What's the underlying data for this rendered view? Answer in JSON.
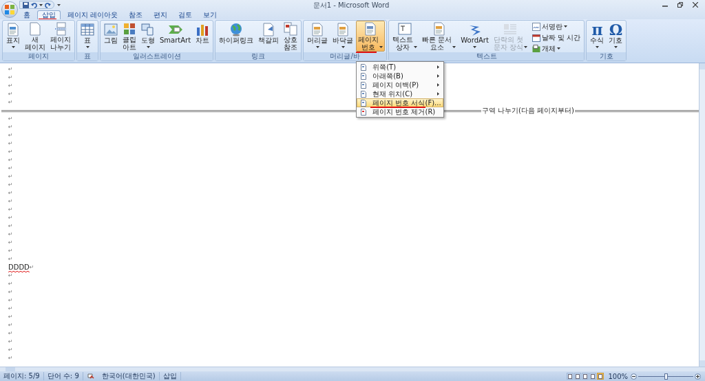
{
  "window": {
    "title": "문서1 - Microsoft Word"
  },
  "tabs": [
    {
      "label": "홈",
      "selected": false
    },
    {
      "label": "삽입",
      "selected": true
    },
    {
      "label": "페이지 레이아웃",
      "selected": false
    },
    {
      "label": "참조",
      "selected": false
    },
    {
      "label": "편지",
      "selected": false
    },
    {
      "label": "검토",
      "selected": false
    },
    {
      "label": "보기",
      "selected": false
    }
  ],
  "ribbon": {
    "groups": [
      {
        "label": "페이지",
        "buttons": [
          {
            "kind": "large",
            "label": "표지",
            "dropdown": true,
            "pressed": false,
            "disabled": false
          },
          {
            "kind": "large",
            "label": "새\n페이지",
            "dropdown": false,
            "pressed": false,
            "disabled": false
          },
          {
            "kind": "large",
            "label": "페이지\n나누기",
            "dropdown": false,
            "pressed": false,
            "disabled": false
          }
        ]
      },
      {
        "label": "표",
        "buttons": [
          {
            "kind": "large",
            "label": "표",
            "dropdown": true,
            "pressed": false,
            "disabled": false
          }
        ]
      },
      {
        "label": "일러스트레이션",
        "buttons": [
          {
            "kind": "large",
            "label": "그림",
            "dropdown": false,
            "pressed": false,
            "disabled": false
          },
          {
            "kind": "large",
            "label": "클립\n아트",
            "dropdown": false,
            "pressed": false,
            "disabled": false
          },
          {
            "kind": "large",
            "label": "도형",
            "dropdown": true,
            "pressed": false,
            "disabled": false
          },
          {
            "kind": "large",
            "label": "SmartArt",
            "dropdown": false,
            "pressed": false,
            "disabled": false
          },
          {
            "kind": "large",
            "label": "차트",
            "dropdown": false,
            "pressed": false,
            "disabled": false
          }
        ]
      },
      {
        "label": "링크",
        "buttons": [
          {
            "kind": "large",
            "label": "하이퍼링크",
            "dropdown": false,
            "pressed": false,
            "disabled": false
          },
          {
            "kind": "large",
            "label": "책갈피",
            "dropdown": false,
            "pressed": false,
            "disabled": false
          },
          {
            "kind": "large",
            "label": "상호\n참조",
            "dropdown": false,
            "pressed": false,
            "disabled": false
          }
        ]
      },
      {
        "label": "머리글/바",
        "buttons": [
          {
            "kind": "large",
            "label": "머리글",
            "dropdown": true,
            "pressed": false,
            "disabled": false
          },
          {
            "kind": "large",
            "label": "바닥글",
            "dropdown": true,
            "pressed": false,
            "disabled": false
          },
          {
            "kind": "large",
            "label": "페이지\n번호",
            "dropdown": true,
            "pressed": true,
            "disabled": false
          }
        ]
      },
      {
        "label": "텍스트",
        "buttons": [
          {
            "kind": "large",
            "label": "텍스트\n상자",
            "dropdown": true,
            "pressed": false,
            "disabled": false
          },
          {
            "kind": "large",
            "label": "빠른 문서\n요소",
            "dropdown": true,
            "pressed": false,
            "disabled": false
          },
          {
            "kind": "large",
            "label": "WordArt",
            "dropdown": true,
            "pressed": false,
            "disabled": false
          },
          {
            "kind": "large",
            "label": "단락의 첫\n문자 장식",
            "dropdown": true,
            "pressed": false,
            "disabled": true
          },
          {
            "kind": "small",
            "label": "서명란",
            "dropdown": true,
            "pressed": false,
            "disabled": false
          },
          {
            "kind": "small",
            "label": "날짜 및 시간",
            "dropdown": false,
            "pressed": false,
            "disabled": false
          },
          {
            "kind": "small",
            "label": "개체",
            "dropdown": true,
            "pressed": false,
            "disabled": false
          }
        ]
      },
      {
        "label": "기호",
        "buttons": [
          {
            "kind": "glyph",
            "glyph": "π",
            "label": "수식",
            "dropdown": true,
            "pressed": false,
            "disabled": false
          },
          {
            "kind": "glyph",
            "glyph": "Ω",
            "label": "기호",
            "dropdown": true,
            "pressed": false,
            "disabled": false
          }
        ]
      }
    ]
  },
  "menu": {
    "items": [
      {
        "label": "위쪽(T)",
        "submenu": true,
        "selected": false
      },
      {
        "label": "아래쪽(B)",
        "submenu": true,
        "selected": false
      },
      {
        "label": "페이지 여백(P)",
        "submenu": true,
        "selected": false
      },
      {
        "label": "현재 위치(C)",
        "submenu": true,
        "selected": false
      },
      {
        "label": "페이지 번호 서식(F)...",
        "submenu": false,
        "selected": true
      },
      {
        "label": "페이지 번호 제거(R)",
        "submenu": false,
        "selected": false
      }
    ]
  },
  "document": {
    "lines": [
      {
        "kind": "empty",
        "mark": "↵"
      },
      {
        "kind": "empty",
        "mark": "↵"
      },
      {
        "kind": "empty",
        "mark": "↵"
      },
      {
        "kind": "empty",
        "mark": "↵"
      },
      {
        "kind": "empty",
        "mark": "↵"
      },
      {
        "kind": "section_break",
        "text": "구역 나누기(다음 페이지부터)"
      },
      {
        "kind": "empty",
        "mark": "↵"
      },
      {
        "kind": "empty",
        "mark": "↵"
      },
      {
        "kind": "empty",
        "mark": "↵"
      },
      {
        "kind": "empty",
        "mark": "↵"
      },
      {
        "kind": "empty",
        "mark": "↵"
      },
      {
        "kind": "empty",
        "mark": "↵"
      },
      {
        "kind": "empty",
        "mark": "↵"
      },
      {
        "kind": "empty",
        "mark": "↵"
      },
      {
        "kind": "empty",
        "mark": "↵"
      },
      {
        "kind": "empty",
        "mark": "↵"
      },
      {
        "kind": "empty",
        "mark": "↵"
      },
      {
        "kind": "empty",
        "mark": "↵"
      },
      {
        "kind": "empty",
        "mark": "↵"
      },
      {
        "kind": "empty",
        "mark": "↵"
      },
      {
        "kind": "empty",
        "mark": "↵"
      },
      {
        "kind": "empty",
        "mark": "↵"
      },
      {
        "kind": "empty",
        "mark": "↵"
      },
      {
        "kind": "empty",
        "mark": "↵"
      },
      {
        "kind": "para",
        "text": "DDDD",
        "mark": "↵",
        "misspelled": true
      },
      {
        "kind": "empty",
        "mark": "↵"
      },
      {
        "kind": "empty",
        "mark": "↵"
      },
      {
        "kind": "empty",
        "mark": "↵"
      },
      {
        "kind": "empty",
        "mark": "↵"
      },
      {
        "kind": "empty",
        "mark": "↵"
      },
      {
        "kind": "empty",
        "mark": "↵"
      },
      {
        "kind": "empty",
        "mark": "↵"
      },
      {
        "kind": "empty",
        "mark": "↵"
      },
      {
        "kind": "empty",
        "mark": "↵"
      },
      {
        "kind": "empty",
        "mark": "↵"
      },
      {
        "kind": "empty",
        "mark": "↵"
      }
    ]
  },
  "status_bar": {
    "items": [
      "페이지: 5/9",
      "단어 수: 9",
      "한국어(대한민국)",
      "삽입"
    ],
    "views": [
      {
        "selected": false
      },
      {
        "selected": false
      },
      {
        "selected": false
      },
      {
        "selected": false
      },
      {
        "selected": true
      }
    ],
    "zoom": "100%",
    "zoom_slider": {
      "level": 0.5
    }
  }
}
